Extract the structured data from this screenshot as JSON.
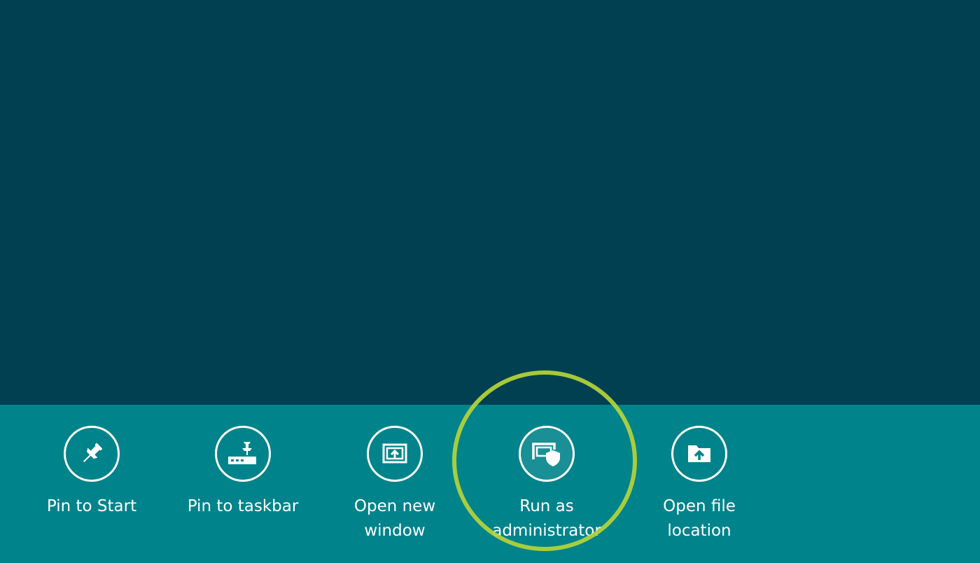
{
  "app_bar": {
    "commands": [
      {
        "label": "Pin to Start",
        "icon": "pin-icon"
      },
      {
        "label": "Pin to taskbar",
        "icon": "pin-taskbar-icon"
      },
      {
        "label": "Open new\nwindow",
        "icon": "new-window-icon"
      },
      {
        "label": "Run as\nadministrator",
        "icon": "shield-window-icon"
      },
      {
        "label": "Open file\nlocation",
        "icon": "folder-up-icon"
      }
    ]
  },
  "colors": {
    "start_background": "#004050",
    "app_bar_background": "#00838a",
    "highlight": "#b5d43a",
    "foreground": "#ffffff"
  }
}
